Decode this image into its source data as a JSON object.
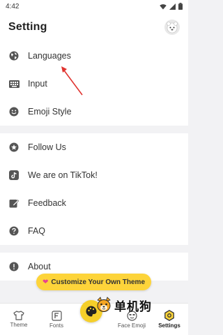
{
  "status_bar": {
    "time": "4:42"
  },
  "header": {
    "title": "Setting"
  },
  "groups": [
    {
      "items": [
        {
          "label": "Languages",
          "icon": "globe-icon"
        },
        {
          "label": "Input",
          "icon": "keyboard-icon"
        },
        {
          "label": "Emoji Style",
          "icon": "smiley-icon"
        }
      ]
    },
    {
      "items": [
        {
          "label": "Follow Us",
          "icon": "star-icon"
        },
        {
          "label": "We are on TikTok!",
          "icon": "tiktok-icon"
        },
        {
          "label": "Feedback",
          "icon": "edit-icon"
        },
        {
          "label": "FAQ",
          "icon": "help-icon"
        }
      ]
    },
    {
      "items": [
        {
          "label": "About",
          "icon": "info-icon"
        }
      ]
    }
  ],
  "promo": {
    "label": "Customize Your Own Theme"
  },
  "tabbar": {
    "tabs": [
      {
        "label": "Theme",
        "icon": "tshirt-icon"
      },
      {
        "label": "Fonts",
        "icon": "font-icon"
      },
      {
        "label": "",
        "icon": "palette-icon"
      },
      {
        "label": "Face Emoji",
        "icon": "face-icon"
      },
      {
        "label": "Settings",
        "icon": "settings-icon",
        "active": true
      }
    ]
  },
  "watermark": {
    "text": "单机狗"
  },
  "colors": {
    "accent": "#fdd43a",
    "heart": "#e8428e",
    "arrow": "#e0332f"
  }
}
